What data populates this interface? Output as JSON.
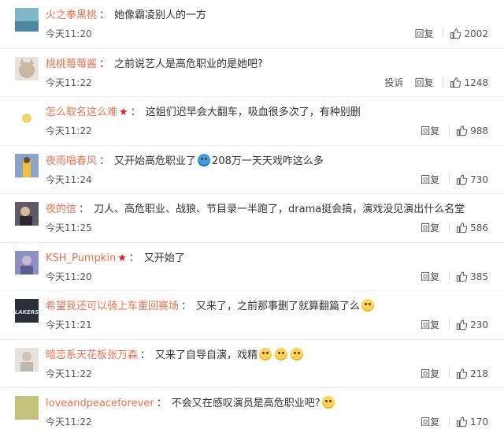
{
  "comments": [
    {
      "username": "火之拳黑桃",
      "text": "她像霸凌别人的一方",
      "time": "今天11:20",
      "actions": [
        "回复"
      ],
      "likes": "2002",
      "avatar_color": "#7fb6c8"
    },
    {
      "username": "桃桃莓莓酱",
      "text": "之前说艺人是高危职业的是她吧?",
      "time": "今天11:22",
      "actions": [
        "投诉",
        "回复"
      ],
      "likes": "1248",
      "avatar_color": "#c9b7a4"
    },
    {
      "username": "怎么取名这么难",
      "vip": "★",
      "text": "这姐们迟早会大翻车，吸血很多次了，有种别删",
      "time": "今天11:22",
      "actions": [
        "回复"
      ],
      "likes": "988",
      "avatar_color": "#f6e7a8"
    },
    {
      "username": "夜雨唱春风",
      "text_before": "又开始高危职业了",
      "text_after": "208万一天天戏咋这么多",
      "time": "今天11:24",
      "actions": [
        "回复"
      ],
      "likes": "730",
      "avatar_color": "#8aa3c9"
    },
    {
      "username": "夜的信",
      "text": "刀人、高危职业、战狼、节目录一半跑了，drama挺会搞，演戏没见演出什么名堂",
      "time": "今天11:25",
      "actions": [
        "回复"
      ],
      "likes": "586",
      "avatar_color": "#5f5a66"
    },
    {
      "username": "KSH_Pumpkin",
      "vip": "★",
      "text": "又开始了",
      "time": "今天11:20",
      "actions": [
        "回复"
      ],
      "likes": "385",
      "avatar_color": "#8c8fc2"
    },
    {
      "username": "希望我还可以骑上车重回赛场",
      "text": "又来了，之前那事删了就算翻篇了么",
      "time": "今天11:21",
      "actions": [
        "回复"
      ],
      "likes": "230",
      "avatar_color": "#2b2f3a",
      "avatar_text": "LAKERS"
    },
    {
      "username": "暗恋系天花板张万森",
      "text": "又来了自导自演，戏精",
      "time": "今天11:22",
      "actions": [
        "回复"
      ],
      "likes": "218",
      "avatar_color": "#d9d4cf"
    },
    {
      "username": "loveandpeaceforever",
      "text": "不会又在感叹演员是高危职业吧?",
      "time": "今天11:22",
      "actions": [
        "回复"
      ],
      "likes": "170",
      "avatar_color": "#c3c27a"
    }
  ]
}
